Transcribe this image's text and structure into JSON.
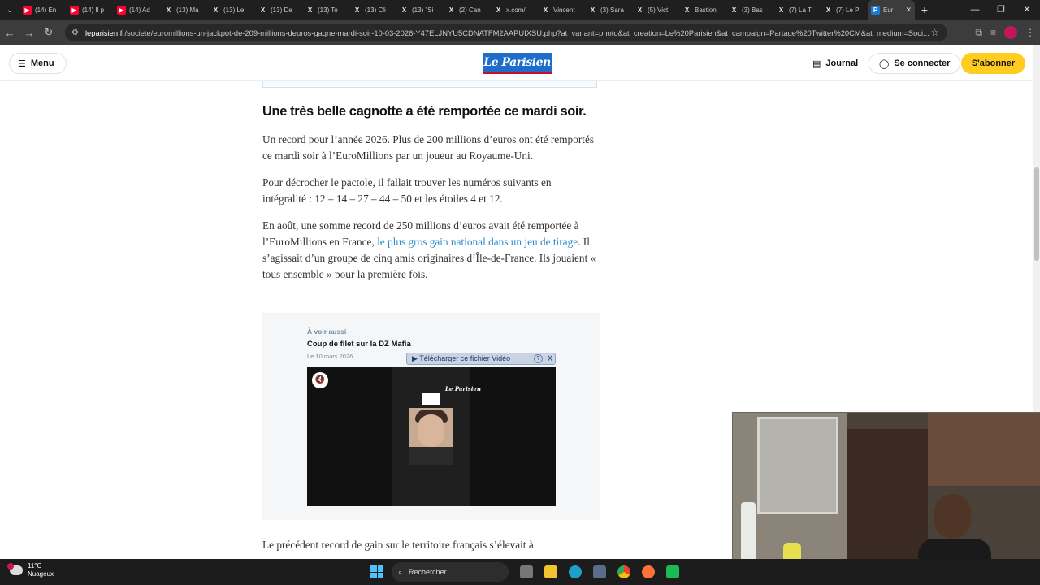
{
  "browser": {
    "tabs": [
      {
        "icon": "youtube",
        "label": "(14) En"
      },
      {
        "icon": "youtube",
        "label": "(14) Il p"
      },
      {
        "icon": "youtube",
        "label": "(14) Ad"
      },
      {
        "icon": "x",
        "label": "(13) Ma"
      },
      {
        "icon": "x",
        "label": "(13) Le"
      },
      {
        "icon": "x",
        "label": "(13) De"
      },
      {
        "icon": "x",
        "label": "(13) To"
      },
      {
        "icon": "x",
        "label": "(13) Cli"
      },
      {
        "icon": "x",
        "label": "(13) \"Si"
      },
      {
        "icon": "x",
        "label": "(2) Can"
      },
      {
        "icon": "x",
        "label": "x.com/"
      },
      {
        "icon": "x",
        "label": "Vincent"
      },
      {
        "icon": "x",
        "label": "(3) Sara"
      },
      {
        "icon": "x",
        "label": "(5) Vict"
      },
      {
        "icon": "x",
        "label": "Bastion"
      },
      {
        "icon": "x",
        "label": "(3) Bas"
      },
      {
        "icon": "x",
        "label": "(7) La T"
      },
      {
        "icon": "x",
        "label": "(7) Le P"
      },
      {
        "icon": "leparisien",
        "label": "Eur"
      }
    ],
    "url_domain": "leparisien.fr",
    "url_path": "/societe/euromillions-un-jackpot-de-209-millions-deuros-gagne-mardi-soir-10-03-2026-Y47ELJNYU5CDNATFM2AAPUIXSU.php?at_variant=photo&at_creation=Le%20Parisien&at_campaign=Partage%20Twitter%20CM&at_medium=Soci..."
  },
  "site": {
    "menu_label": "Menu",
    "logo_text": "Le Parisien",
    "journal_label": "Journal",
    "connect_label": "Se connecter",
    "subscribe_label": "S'abonner"
  },
  "article": {
    "heading": "Une très belle cagnotte a été remportée ce mardi soir.",
    "p1": "Un record pour l’année 2026. Plus de 200 millions d’euros ont été remportés ce mardi soir à l’EuroMillions par un joueur au Royaume-Uni.",
    "p2": "Pour décrocher le pactole, il fallait trouver les numéros suivants en intégralité : 12 – 14 – 27 – 44 – 50 et les étoiles 4 et 12.",
    "p3_before": "En août, une somme record de 250 millions d’euros avait été remportée à l’EuroMillions en France, ",
    "p3_link": "le plus gros gain national dans un jeu de tirage",
    "p3_after": ". Il s’agissait d’un groupe de cinq amis originaires d’Île-de-France. Ils jouaient « tous ensemble » pour la première fois.",
    "p4": "Le précédent record de gain sur le territoire français s’élevait à"
  },
  "voir_aussi": {
    "kicker": "À voir aussi",
    "title": "Coup de filet sur la DZ Mafia",
    "date": "Le 10 mars 2026",
    "download_label": "▶ Télécharger ce fichier Vidéo",
    "download_help": "?",
    "download_close": "X",
    "video_logo": "Le Parisien"
  },
  "taskbar": {
    "temperature": "11°C",
    "weather": "Nuageux",
    "search_label": "Rechercher"
  },
  "colors": {
    "accent_link": "#2a8ccc",
    "subscribe_bg": "#ffcc1f",
    "logo_bg": "#1e6dc8"
  }
}
